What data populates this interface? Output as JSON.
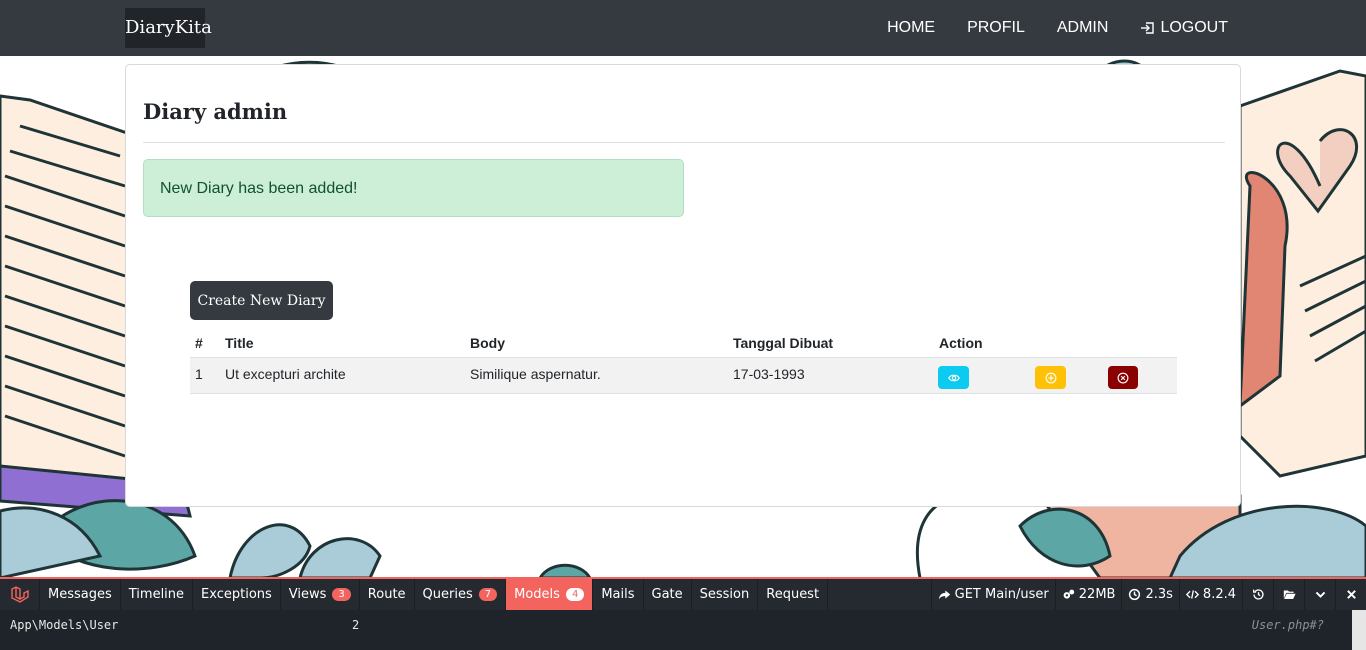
{
  "navbar": {
    "brand": "DiaryKita",
    "links": [
      "HOME",
      "PROFIL",
      "ADMIN"
    ],
    "logout": "LOGOUT"
  },
  "card": {
    "title": "Diary admin",
    "alert": "New Diary has been added!",
    "create_button": "Create New Diary"
  },
  "table": {
    "headers": [
      "#",
      "Title",
      "Body",
      "Tanggal Dibuat",
      "Action"
    ],
    "rows": [
      {
        "no": "1",
        "title": "Ut excepturi archite",
        "body": "Similique aspernatur.",
        "date": "17-03-1993"
      }
    ]
  },
  "debugbar": {
    "tabs": [
      {
        "label": "Messages"
      },
      {
        "label": "Timeline"
      },
      {
        "label": "Exceptions"
      },
      {
        "label": "Views",
        "badge": "3"
      },
      {
        "label": "Route"
      },
      {
        "label": "Queries",
        "badge": "7"
      },
      {
        "label": "Models",
        "badge": "4"
      },
      {
        "label": "Mails"
      },
      {
        "label": "Gate"
      },
      {
        "label": "Session"
      },
      {
        "label": "Request"
      }
    ],
    "request": "GET Main/user",
    "memory": "22MB",
    "time": "2.3s",
    "php": "8.2.4",
    "model_row": {
      "model": "App\\Models\\User",
      "count": "2",
      "file": "User.php#?"
    }
  },
  "colors": {
    "navbar": "#343a40",
    "alert_bg": "#cdefd8",
    "view": "#0dcaf0",
    "edit": "#ffc107",
    "delete": "#8b0000",
    "debug_accent": "#f4645f"
  }
}
